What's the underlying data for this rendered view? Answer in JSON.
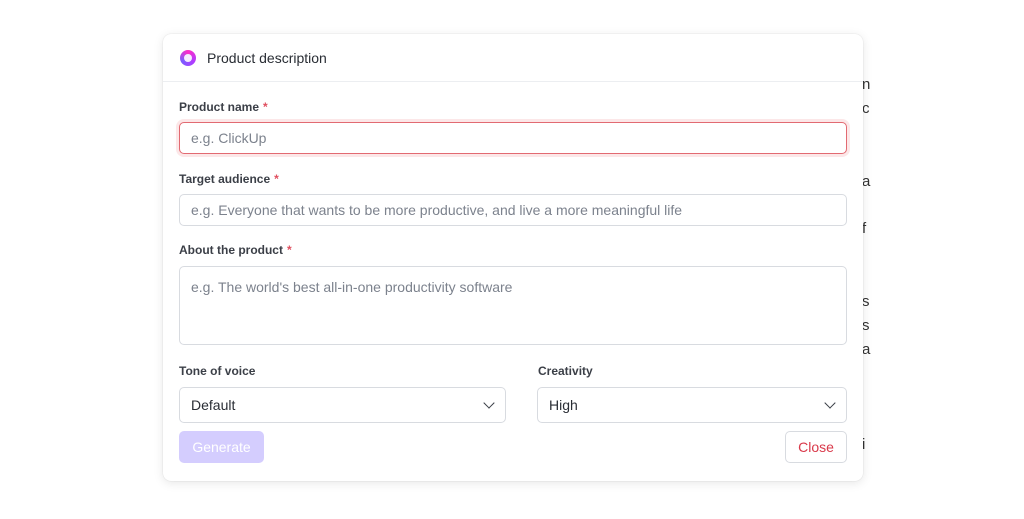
{
  "modal": {
    "title": "Product description",
    "logo_icon": "clickup-ai-icon"
  },
  "fields": {
    "product_name": {
      "label": "Product name",
      "required_mark": "*",
      "placeholder": "e.g. ClickUp",
      "value": ""
    },
    "target_audience": {
      "label": "Target audience",
      "required_mark": "*",
      "placeholder": "e.g. Everyone that wants to be more productive, and live a more meaningful life",
      "value": ""
    },
    "about_product": {
      "label": "About the product",
      "required_mark": "*",
      "placeholder": "e.g. The world's best all-in-one productivity software",
      "value": ""
    },
    "tone_of_voice": {
      "label": "Tone of voice",
      "selected": "Default"
    },
    "creativity": {
      "label": "Creativity",
      "selected": "High"
    }
  },
  "actions": {
    "generate_label": "Generate",
    "close_label": "Close"
  },
  "colors": {
    "required": "#e04f5f",
    "focus_border": "#e26a72",
    "generate_disabled": "#d4cdfe",
    "close_text": "#d9394a"
  }
}
